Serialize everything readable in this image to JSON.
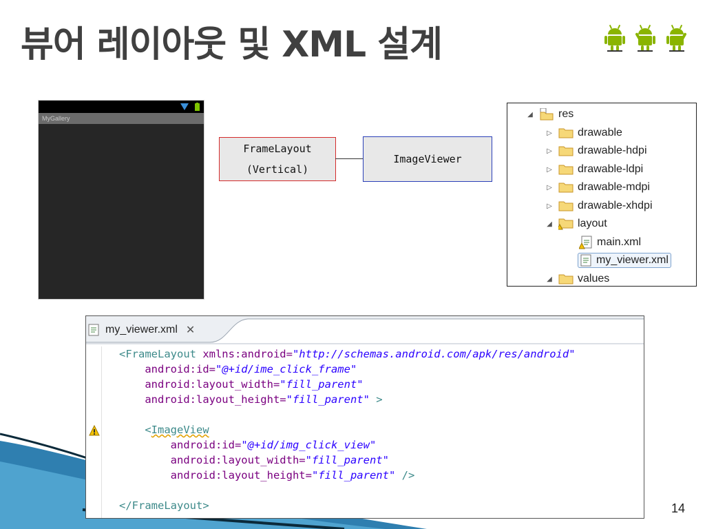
{
  "slide": {
    "title": "뷰어 레이아웃 및 XML 설계",
    "page_number": "14"
  },
  "phone": {
    "app_title": "MyGallery"
  },
  "diagram": {
    "frame_line1": "FrameLayout",
    "frame_line2": "(Vertical)",
    "image_box": "ImageViewer"
  },
  "tree": {
    "items": [
      {
        "label": "res",
        "expanded": true
      },
      {
        "label": "drawable",
        "expanded": false
      },
      {
        "label": "drawable-hdpi",
        "expanded": false
      },
      {
        "label": "drawable-ldpi",
        "expanded": false
      },
      {
        "label": "drawable-mdpi",
        "expanded": false
      },
      {
        "label": "drawable-xhdpi",
        "expanded": false
      },
      {
        "label": "layout",
        "expanded": true
      },
      {
        "label": "main.xml"
      },
      {
        "label": "my_viewer.xml",
        "selected": true
      },
      {
        "label": "values",
        "expanded": true
      }
    ]
  },
  "editor": {
    "tab_label": "my_viewer.xml",
    "code": {
      "l1_tag": "<FrameLayout",
      "l1_attr": " xmlns:android=",
      "l1_val": "\"http://schemas.android.com/apk/res/android\"",
      "l2_attr": "android:id=",
      "l2_val": "\"@+id/ime_click_frame\"",
      "l3_attr": "android:layout_width=",
      "l3_val": "\"fill_parent\"",
      "l4_attr": "android:layout_height=",
      "l4_val": "\"fill_parent\"",
      "l4_end": " >",
      "l6_tag_lt": "<",
      "l6_tag": "ImageView",
      "l7_attr": "android:id=",
      "l7_val": "\"@+id/img_click_view\"",
      "l8_attr": "android:layout_width=",
      "l8_val": "\"fill_parent\"",
      "l9_attr": "android:layout_height=",
      "l9_val": "\"fill_parent\"",
      "l9_end": " />",
      "l11_tag": "</FrameLayout>"
    }
  },
  "colors": {
    "frame_border": "#d42a2a",
    "image_border": "#2a3fb8",
    "android_green": "#8ab400"
  }
}
